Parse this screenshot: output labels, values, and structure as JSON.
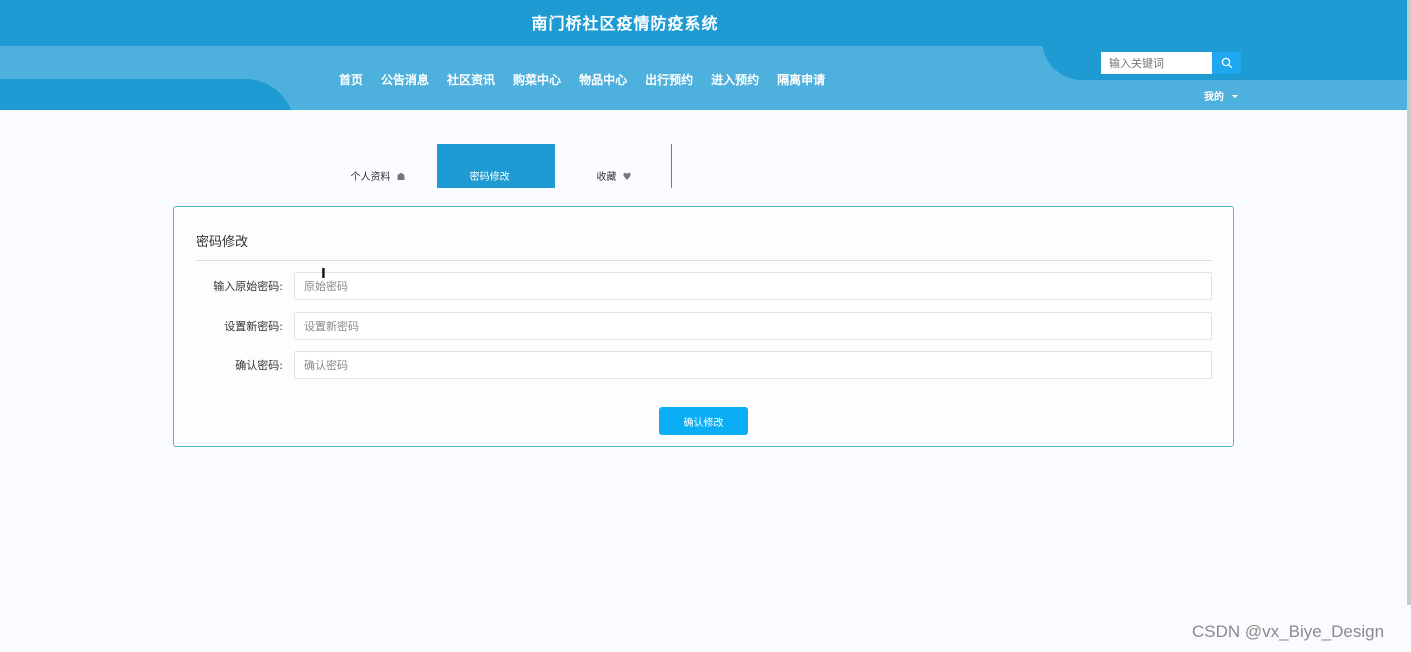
{
  "header": {
    "title": "南门桥社区疫情防疫系统",
    "nav": [
      "首页",
      "公告消息",
      "社区资讯",
      "购菜中心",
      "物品中心",
      "出行预约",
      "进入预约",
      "隔离申请"
    ],
    "search_placeholder": "输入关键词",
    "mine_label": "我的"
  },
  "tabs": [
    {
      "label": "个人资料",
      "icon": "house-icon",
      "active": false
    },
    {
      "label": "密码修改",
      "icon": "lock-icon",
      "active": true
    },
    {
      "label": "收藏",
      "icon": "heart-icon",
      "active": false
    }
  ],
  "form": {
    "title": "密码修改",
    "fields": [
      {
        "label": "输入原始密码:",
        "placeholder": "原始密码"
      },
      {
        "label": "设置新密码:",
        "placeholder": "设置新密码"
      },
      {
        "label": "确认密码:",
        "placeholder": "确认密码"
      }
    ],
    "submit_label": "确认修改"
  },
  "watermark": "CSDN @vx_Biye_Design",
  "colors": {
    "primary": "#1e9bd3",
    "header_light": "#4eb0dc",
    "button": "#0baef5",
    "panel_border": "#4fb8d6"
  }
}
